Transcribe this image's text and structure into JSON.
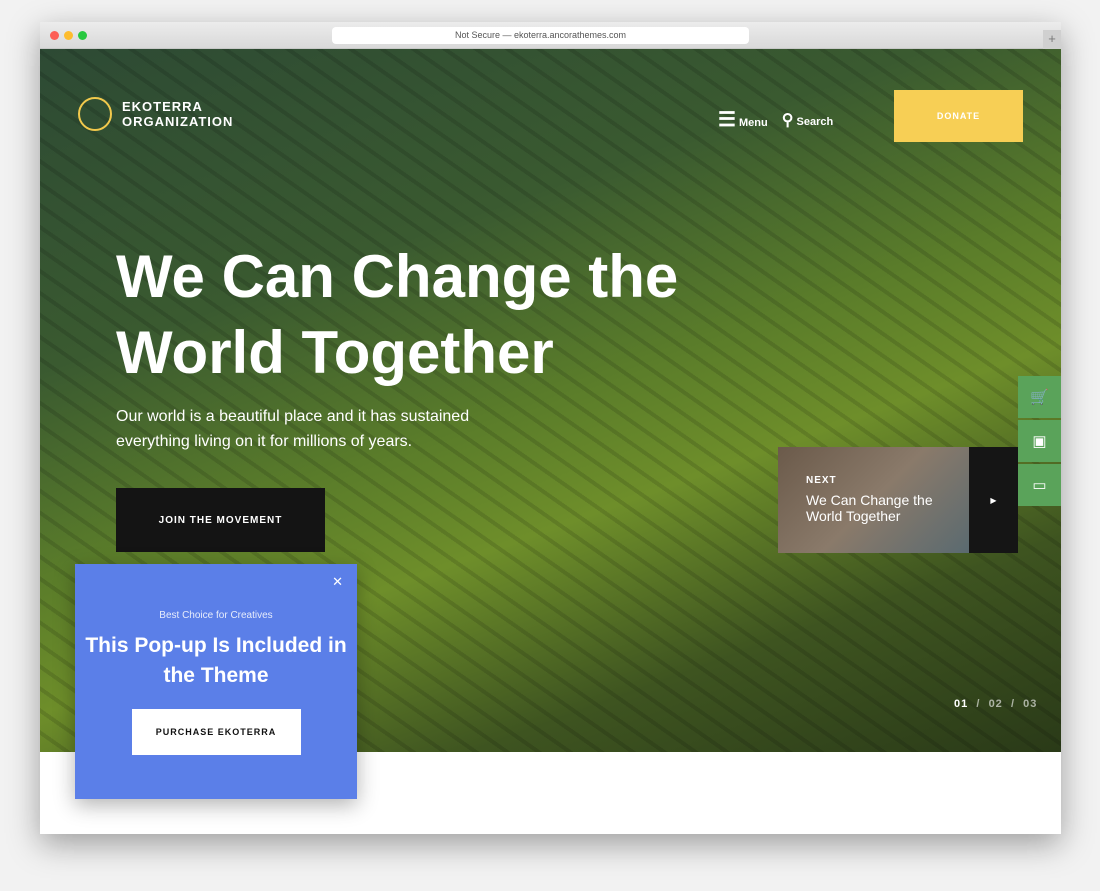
{
  "browser": {
    "url": "Not Secure — ekoterra.ancorathemes.com"
  },
  "header": {
    "logo_line1": "EKOTERRA",
    "logo_line2": "ORGANIZATION",
    "menu": "Menu",
    "search": "Search",
    "donate": "DONATE"
  },
  "hero": {
    "title": "We Can Change the World Together",
    "subtitle": "Our world is a beautiful place and it has sustained everything living on it for millions of years.",
    "cta": "JOIN THE MOVEMENT"
  },
  "next_slide": {
    "label": "NEXT",
    "title": "We Can Change the World Together"
  },
  "pager": {
    "current": "01",
    "sep": "/",
    "p2": "02",
    "p3": "03"
  },
  "side_icons": [
    "cart-icon",
    "gallery-icon",
    "window-icon"
  ],
  "popup": {
    "kicker": "Best Choice for Creatives",
    "title": "This Pop-up Is Included in the Theme",
    "button": "PURCHASE EKOTERRA"
  },
  "colors": {
    "accent": "#f7cf55",
    "popup": "#5b7fe8",
    "side": "#5aa35a"
  }
}
